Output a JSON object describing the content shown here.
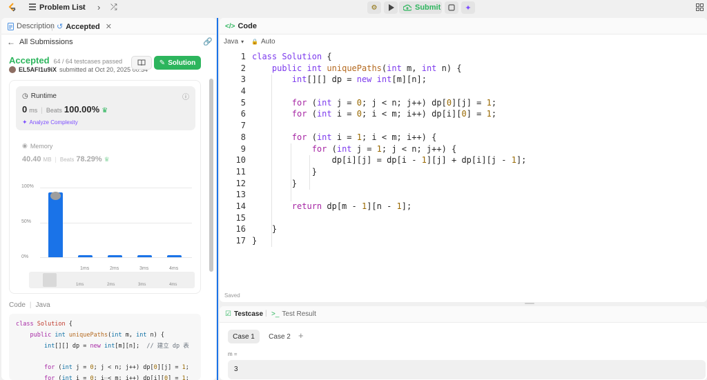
{
  "topbar": {
    "problem_list": "Problem List",
    "submit": "Submit"
  },
  "left": {
    "tabs": {
      "description": "Description",
      "accepted": "Accepted"
    },
    "all_submissions": "All Submissions",
    "status": "Accepted",
    "testcases": "64 / 64 testcases passed",
    "user": "EL5AFl1u9iX",
    "submitted_at": "submitted at Oct 20, 2025 00:34",
    "solution_btn": "Solution",
    "runtime": {
      "label": "Runtime",
      "value": "0",
      "unit": "ms",
      "beats_label": "Beats",
      "beats": "100.00%",
      "analyze": "Analyze Complexity"
    },
    "memory": {
      "label": "Memory",
      "value": "40.40",
      "unit": "MB",
      "beats_label": "Beats",
      "beats": "78.29%"
    },
    "chart_y": [
      "100%",
      "50%",
      "0%"
    ],
    "chart_x": [
      "1ms",
      "2ms",
      "3ms",
      "4ms"
    ],
    "mini_x": [
      "1ms",
      "2ms",
      "3ms",
      "4ms"
    ],
    "code_header": {
      "code": "Code",
      "lang": "Java"
    },
    "preview_lines": [
      "class Solution {",
      "    public int uniquePaths(int m, int n) {",
      "        int[][] dp = new int[m][n];  // 建立 dp 表",
      "",
      "        for (int j = 0; j < n; j++) dp[0][j] = 1;",
      "        for (int i = 0; i < m; i++) dp[i][0] = 1;"
    ]
  },
  "chart_data": {
    "type": "bar",
    "categories": [
      "0ms",
      "1ms",
      "2ms",
      "3ms",
      "4ms"
    ],
    "values": [
      93,
      2,
      2,
      2,
      2
    ],
    "ylim": [
      0,
      100
    ],
    "yticks": [
      "100%",
      "50%",
      "0%"
    ],
    "xlabel": "",
    "ylabel": ""
  },
  "editor": {
    "title": "Code",
    "language": "Java",
    "mode": "Auto",
    "saved": "Saved",
    "line_numbers": [
      "1",
      "2",
      "3",
      "4",
      "5",
      "6",
      "7",
      "8",
      "9",
      "10",
      "11",
      "12",
      "13",
      "14",
      "15",
      "16",
      "17"
    ]
  },
  "testpanel": {
    "testcase_tab": "Testcase",
    "result_tab": "Test Result",
    "case1": "Case 1",
    "case2": "Case 2",
    "add": "+",
    "var_label": "m =",
    "var_value": "3"
  },
  "colors": {
    "accent_green": "#2db55d",
    "bar_blue": "#1a73e8",
    "orange_status": "#ffa116"
  }
}
